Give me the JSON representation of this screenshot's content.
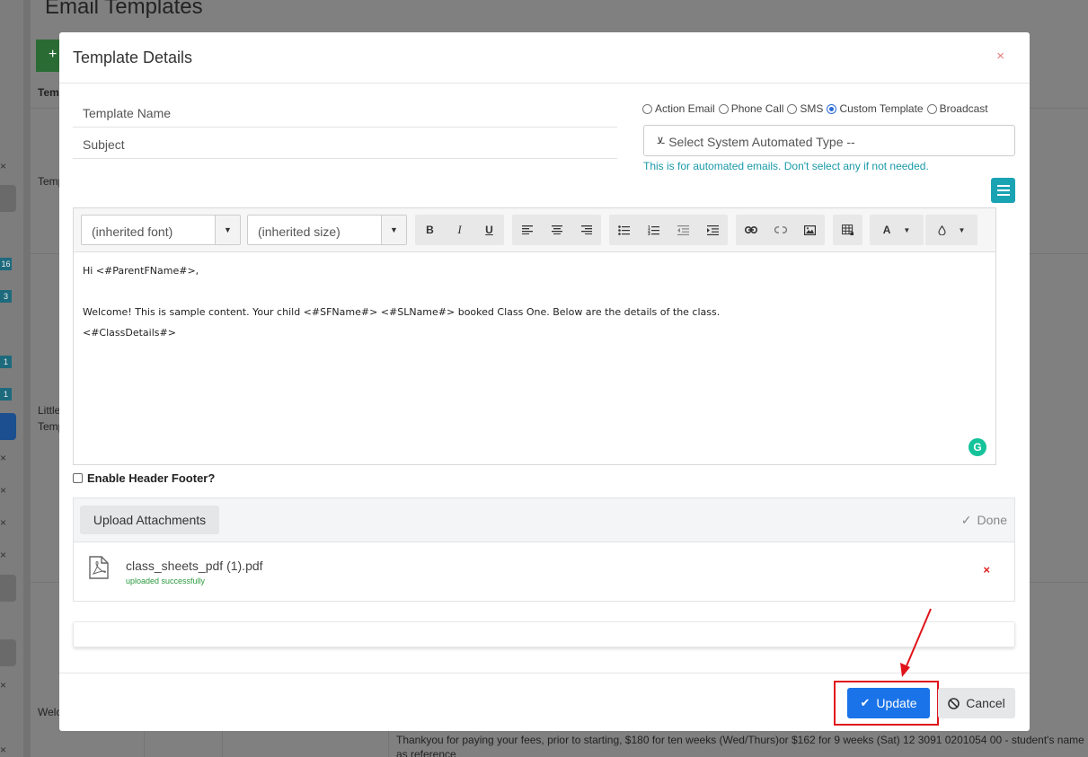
{
  "background": {
    "page_title": "Email Templates",
    "add_button": "+",
    "column_header": "Tem",
    "row_texts": [
      "Temp",
      "Little",
      "Temp",
      "Welc"
    ],
    "badges": [
      "16",
      "3",
      "1",
      "1"
    ],
    "footer_text": "Thankyou for paying your fees, prior to starting, $180 for ten weeks (Wed/Thurs)or $162 for 9 weeks (Sat) 12 3091 0201054 00 - student's name as reference"
  },
  "modal": {
    "title": "Template Details",
    "close": "×",
    "template_name_label": "Template Name",
    "subject_label": "Subject",
    "radio_options": [
      {
        "label": "Action Email",
        "selected": false
      },
      {
        "label": "Phone Call",
        "selected": false
      },
      {
        "label": "SMS",
        "selected": false
      },
      {
        "label": "Custom Template",
        "selected": true
      },
      {
        "label": "Broadcast",
        "selected": false
      }
    ],
    "system_type_select": "-- Select System Automated Type --",
    "help_text": "This is for automated emails. Don't select any if not needed.",
    "menu_icon": "hamburger-icon"
  },
  "editor": {
    "font_select": "(inherited font)",
    "size_select": "(inherited size)",
    "bold": "B",
    "italic": "I",
    "underline": "U",
    "color_text": "A",
    "content_lines": [
      "Hi <#ParentFName#>,",
      "",
      "Welcome! This is sample content. Your child <#SFName#> <#SLName#> booked Class One. Below are the details of the class.",
      "<#ClassDetails#>"
    ],
    "grammarly": "G"
  },
  "options": {
    "enable_header_footer": "Enable Header Footer?"
  },
  "attachments": {
    "upload_button": "Upload Attachments",
    "done_label": "Done",
    "files": [
      {
        "name": "class_sheets_pdf (1).pdf",
        "status": "uploaded successfully"
      }
    ],
    "delete": "×"
  },
  "footer": {
    "update_label": "Update",
    "cancel_label": "Cancel"
  },
  "colors": {
    "primary": "#1a73e8",
    "teal": "#1aa3b3",
    "highlight": "#e0141b",
    "success": "#2a9a3e"
  }
}
